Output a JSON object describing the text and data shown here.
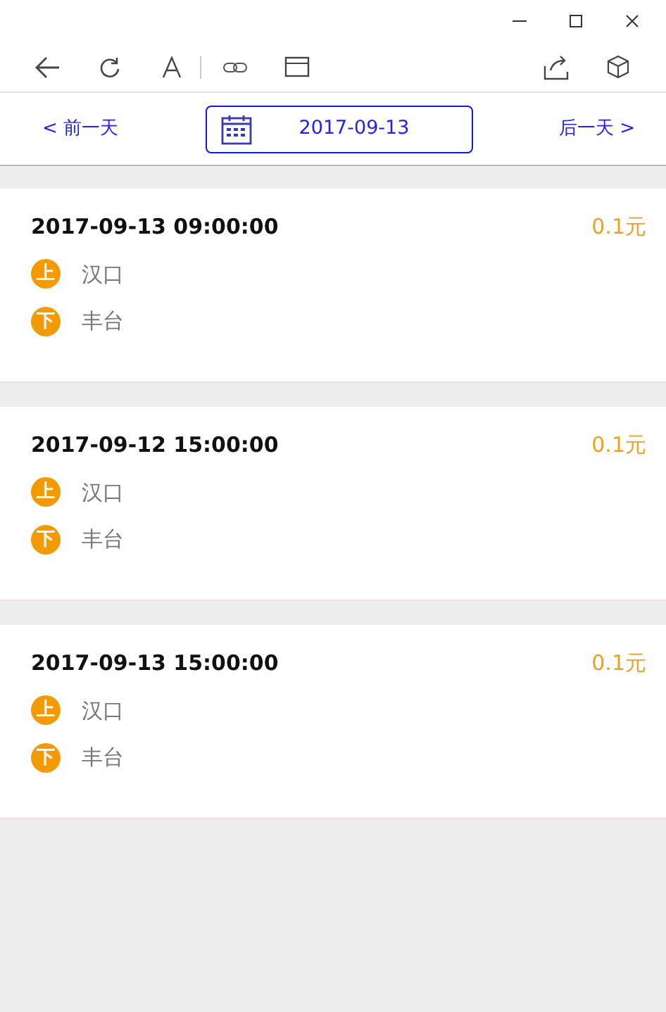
{
  "date_nav": {
    "prev": "< 前一天",
    "date": "2017-09-13",
    "next": "后一天 >"
  },
  "trips": [
    {
      "time": "2017-09-13 09:00:00",
      "price": "0.1元",
      "stops": [
        {
          "mark": "上",
          "name": "汉口"
        },
        {
          "mark": "下",
          "name": "丰台"
        }
      ]
    },
    {
      "time": "2017-09-12 15:00:00",
      "price": "0.1元",
      "stops": [
        {
          "mark": "上",
          "name": "汉口"
        },
        {
          "mark": "下",
          "name": "丰台"
        }
      ]
    },
    {
      "time": "2017-09-13 15:00:00",
      "price": "0.1元",
      "stops": [
        {
          "mark": "上",
          "name": "汉口"
        },
        {
          "mark": "下",
          "name": "丰台"
        }
      ]
    }
  ]
}
